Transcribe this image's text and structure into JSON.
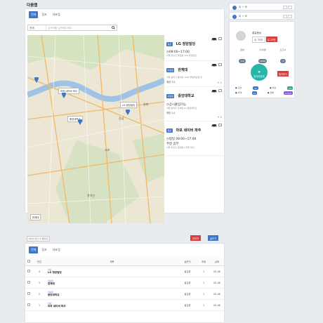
{
  "title": "다음맵",
  "tabs": [
    "전체",
    "점포",
    "대표점"
  ],
  "search": {
    "select": "전체",
    "placeholder": "검색어를 입력해주세요"
  },
  "map": {
    "labels": [
      "마포 네이버 파주",
      "중앙대학교",
      "LG 청담빌딩",
      "한체대"
    ],
    "place_names": [
      "강남",
      "서초",
      "송파",
      "관악산",
      "한강"
    ]
  },
  "places": [
    {
      "badge": "점포",
      "name": "LG 청담빌딩",
      "hours": "09:00~17:00",
      "addr": "서울 강남구 청담동 103 청담빌딩",
      "avail": "",
      "plus": ""
    },
    {
      "badge": "대표점",
      "name": "한체대",
      "hours": "",
      "addr": "서울 송파구 방이동 1236 올림픽공원 안",
      "avail": "예정 3.0",
      "plus": "+ 1"
    },
    {
      "badge": "대표점",
      "name": "중앙대학교",
      "hours": "상시출입가능",
      "addr": "서울 동작구 흑석동 67 중앙대학교",
      "avail": "예정 1.0",
      "plus": "+ 1"
    },
    {
      "badge": "점포",
      "name": "마포 네이버 파주",
      "hours": "평일 09:00~17:00",
      "hours2": "주말 휴무",
      "addr": "서울 마포구 공덕동 2 대지 바다",
      "avail": "",
      "plus": ""
    }
  ],
  "side": {
    "row1": "회 + 회",
    "row2": "회 + 회",
    "user": "홍길동님",
    "btn_edit": "내 그리드",
    "btn_logout": "로그아웃",
    "stats": [
      {
        "label": "참여",
        "value": "120"
      },
      {
        "label": "출석/결",
        "value": "18/00"
      },
      {
        "label": "신고/2",
        "value": "15"
      }
    ],
    "circle": "출석하기",
    "circle_label": "접속자접계",
    "circle_btn": "출석하기",
    "rows": [
      {
        "label": "● 오늘",
        "pill1": "12",
        "text": "● 이번",
        "pill2": "43"
      },
      {
        "label": "● 어제",
        "pill1": "11",
        "text": "● 전체",
        "pill2": "5,510"
      }
    ]
  },
  "bottom": {
    "status": "Total 4/1 / 1 페이지",
    "btn_red": "관리자",
    "btn_blue": "글쓰기",
    "tabs": [
      "전체",
      "점포",
      "대표점"
    ],
    "headers": [
      "",
      "번호",
      "제목",
      "글쓴이",
      "조회",
      "날짜"
    ],
    "rows": [
      {
        "num": "4",
        "cat": "점포",
        "name": "LG 청담빌딩",
        "writer": "홍길동",
        "views": "1",
        "date": "05-08"
      },
      {
        "num": "3",
        "cat": "대표점",
        "name": "한체대",
        "writer": "홍길동",
        "views": "1",
        "date": "05-08"
      },
      {
        "num": "2",
        "cat": "대표점",
        "name": "중앙대학교",
        "writer": "홍길동",
        "views": "1",
        "date": "05-08"
      },
      {
        "num": "1",
        "cat": "점포",
        "name": "마포 네이버 파주",
        "writer": "홍길동",
        "views": "1",
        "date": "05-08"
      }
    ]
  }
}
